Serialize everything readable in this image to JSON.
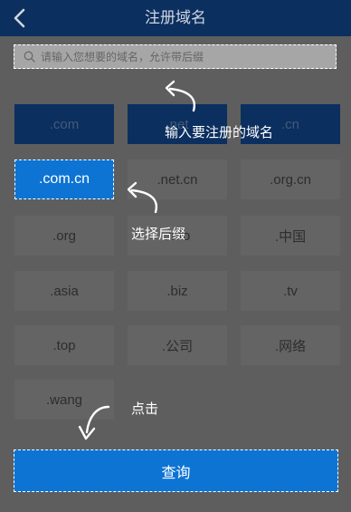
{
  "header": {
    "title": "注册域名",
    "back_icon": "chevron-left-icon"
  },
  "search": {
    "placeholder": "请输入您想要的域名，允许带后缀",
    "icon": "search-icon"
  },
  "suffixes": [
    {
      "label": ".com"
    },
    {
      "label": ".net"
    },
    {
      "label": ".cn"
    },
    {
      "label": ".com.cn"
    },
    {
      "label": ".net.cn"
    },
    {
      "label": ".org.cn"
    },
    {
      "label": ".org"
    },
    {
      "label": ".info"
    },
    {
      "label": ".中国"
    },
    {
      "label": ".asia"
    },
    {
      "label": ".biz"
    },
    {
      "label": ".tv"
    },
    {
      "label": ".top"
    },
    {
      "label": ".公司"
    },
    {
      "label": ".网络"
    },
    {
      "label": ".wang"
    }
  ],
  "selected_suffix": ".com.cn",
  "query_button": {
    "label": "查询"
  },
  "annotations": {
    "enter_domain": "输入要注册的域名",
    "choose_suffix": "选择后缀",
    "click": "点击"
  },
  "colors": {
    "header": "#0b2f5f",
    "accent": "#0d74d4",
    "overlay": "#5e5e5e"
  }
}
